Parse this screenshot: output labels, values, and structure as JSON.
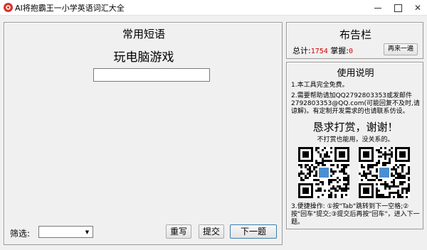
{
  "window": {
    "title": "AI将抱霸王一小学英语词汇大全"
  },
  "main": {
    "category_title": "常用短语",
    "phrase": "玩电脑游戏",
    "answer_value": "",
    "filter_label": "筛选:",
    "filter_value": "",
    "reset_label": "重写",
    "submit_label": "提交",
    "next_label": "下一题"
  },
  "notice": {
    "title": "布告栏",
    "total_label": "总计:",
    "total_value": "1754",
    "mastered_label": "掌握:",
    "mastered_value": "0",
    "refresh_label": "再来一遍"
  },
  "help": {
    "title": "使用说明",
    "line1": "1.本工具完全免费。",
    "line2": "2.需要帮助请加QQ2792803353或发邮件2792803353@QQ.com(可能回复不及时,请谅解)。有定制开发需求的也请联系仿设。",
    "beg": "恳求打赏，谢谢！",
    "beg_sub": "不打赏也能用，没关系的。",
    "line3": "3.便捷操作: ①按\"Tab\"跳转到下一空格;②按\"回车\"提交;③提交后再按\"回车\"，进入下一题。"
  },
  "icons": {
    "app": "app-icon",
    "qr": "qr-code-icon"
  },
  "colors": {
    "accent_red": "#d40000",
    "window_bg": "#f0f0f0"
  }
}
